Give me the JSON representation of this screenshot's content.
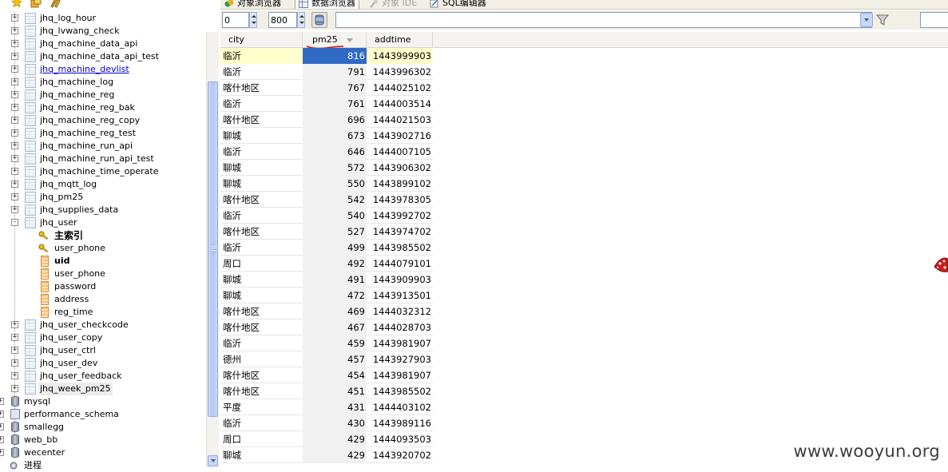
{
  "tabs": [
    {
      "label": "对象浏览器",
      "icon": "object-browser-icon",
      "active": false,
      "disabled": false
    },
    {
      "label": "数据浏览器",
      "icon": "data-browser-icon",
      "active": true,
      "disabled": false
    },
    {
      "label": "对象 IDE",
      "icon": "object-ide-icon",
      "active": false,
      "disabled": true
    },
    {
      "label": "SQL编辑器",
      "icon": "sql-editor-icon",
      "active": false,
      "disabled": false
    }
  ],
  "query": {
    "offset": "0",
    "limit": "800",
    "filter": ""
  },
  "tree": {
    "tables_before": [
      "jhq_log_hour",
      "jhq_lvwang_check",
      "jhq_machine_data_api",
      "jhq_machine_data_api_test",
      "jhq_machine_devlist",
      "jhq_machine_log",
      "jhq_machine_reg",
      "jhq_machine_reg_bak",
      "jhq_machine_reg_copy",
      "jhq_machine_reg_test",
      "jhq_machine_run_api",
      "jhq_machine_run_api_test",
      "jhq_machine_time_operate",
      "jhq_mqtt_log",
      "jhq_pm25",
      "jhq_supplies_data"
    ],
    "expanded_table": "jhq_user",
    "indexes": [
      "主索引",
      "user_phone"
    ],
    "columns": [
      "uid",
      "user_phone",
      "password",
      "address",
      "reg_time"
    ],
    "tables_after": [
      "jhq_user_checkcode",
      "jhq_user_copy",
      "jhq_user_ctrl",
      "jhq_user_dev",
      "jhq_user_feedback",
      "jhq_week_pm25"
    ],
    "databases": [
      "mysql",
      "performance_schema",
      "smallegg",
      "web_bb",
      "wecenter"
    ],
    "process_label": "进程"
  },
  "grid": {
    "columns": [
      "city",
      "pm25",
      "addtime"
    ],
    "rows": [
      [
        "临沂",
        "816",
        "1443999903"
      ],
      [
        "临沂",
        "791",
        "1443996302"
      ],
      [
        "喀什地区",
        "767",
        "1444025102"
      ],
      [
        "临沂",
        "761",
        "1444003514"
      ],
      [
        "喀什地区",
        "696",
        "1444021503"
      ],
      [
        "聊城",
        "673",
        "1443902716"
      ],
      [
        "临沂",
        "646",
        "1444007105"
      ],
      [
        "聊城",
        "572",
        "1443906302"
      ],
      [
        "聊城",
        "550",
        "1443899102"
      ],
      [
        "喀什地区",
        "542",
        "1443978305"
      ],
      [
        "临沂",
        "540",
        "1443992702"
      ],
      [
        "喀什地区",
        "527",
        "1443974702"
      ],
      [
        "临沂",
        "499",
        "1443985502"
      ],
      [
        "周口",
        "492",
        "1444079101"
      ],
      [
        "聊城",
        "491",
        "1443909903"
      ],
      [
        "聊城",
        "472",
        "1443913501"
      ],
      [
        "喀什地区",
        "469",
        "1444032312"
      ],
      [
        "喀什地区",
        "467",
        "1444028703"
      ],
      [
        "临沂",
        "459",
        "1443981907"
      ],
      [
        "德州",
        "457",
        "1443927903"
      ],
      [
        "喀什地区",
        "454",
        "1443981907"
      ],
      [
        "喀什地区",
        "451",
        "1443985502"
      ],
      [
        "平度",
        "431",
        "1444403102"
      ],
      [
        "临沂",
        "430",
        "1443989116"
      ],
      [
        "周口",
        "429",
        "1444093503"
      ],
      [
        "聊城",
        "429",
        "1443920702"
      ]
    ]
  },
  "watermark": "www.wooyun.org"
}
